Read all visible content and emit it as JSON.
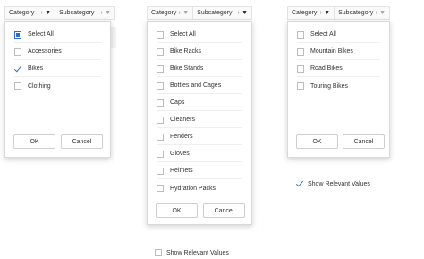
{
  "headers": {
    "category_label": "Category",
    "subcategory_label": "Subcategory",
    "sort_icon": "↑",
    "filter_icon": "▼"
  },
  "panel_left": {
    "items": [
      {
        "label": "Select All",
        "state": "indeterminate"
      },
      {
        "label": "Accessories",
        "state": "unchecked"
      },
      {
        "label": "Bikes",
        "state": "checked"
      },
      {
        "label": "Clothing",
        "state": "unchecked"
      }
    ],
    "ok_label": "OK",
    "cancel_label": "Cancel"
  },
  "panel_mid": {
    "items": [
      {
        "label": "Select All",
        "state": "unchecked"
      },
      {
        "label": "Bike Racks",
        "state": "unchecked"
      },
      {
        "label": "Bike Stands",
        "state": "unchecked"
      },
      {
        "label": "Bottles and Cages",
        "state": "unchecked"
      },
      {
        "label": "Caps",
        "state": "unchecked"
      },
      {
        "label": "Cleaners",
        "state": "unchecked"
      },
      {
        "label": "Fenders",
        "state": "unchecked"
      },
      {
        "label": "Gloves",
        "state": "unchecked"
      },
      {
        "label": "Helmets",
        "state": "unchecked"
      },
      {
        "label": "Hydration Packs",
        "state": "unchecked"
      }
    ],
    "ok_label": "OK",
    "cancel_label": "Cancel",
    "relevant_label": "Show Relevant Values",
    "relevant_checked": false
  },
  "panel_right": {
    "items": [
      {
        "label": "Select All",
        "state": "unchecked"
      },
      {
        "label": "Mountain Bikes",
        "state": "unchecked"
      },
      {
        "label": "Road Bikes",
        "state": "unchecked"
      },
      {
        "label": "Touring Bikes",
        "state": "unchecked"
      }
    ],
    "ok_label": "OK",
    "cancel_label": "Cancel",
    "relevant_label": "Show Relevant Values",
    "relevant_checked": true
  },
  "colors": {
    "accent": "#2f6dbd",
    "border": "#d9d9d9"
  }
}
